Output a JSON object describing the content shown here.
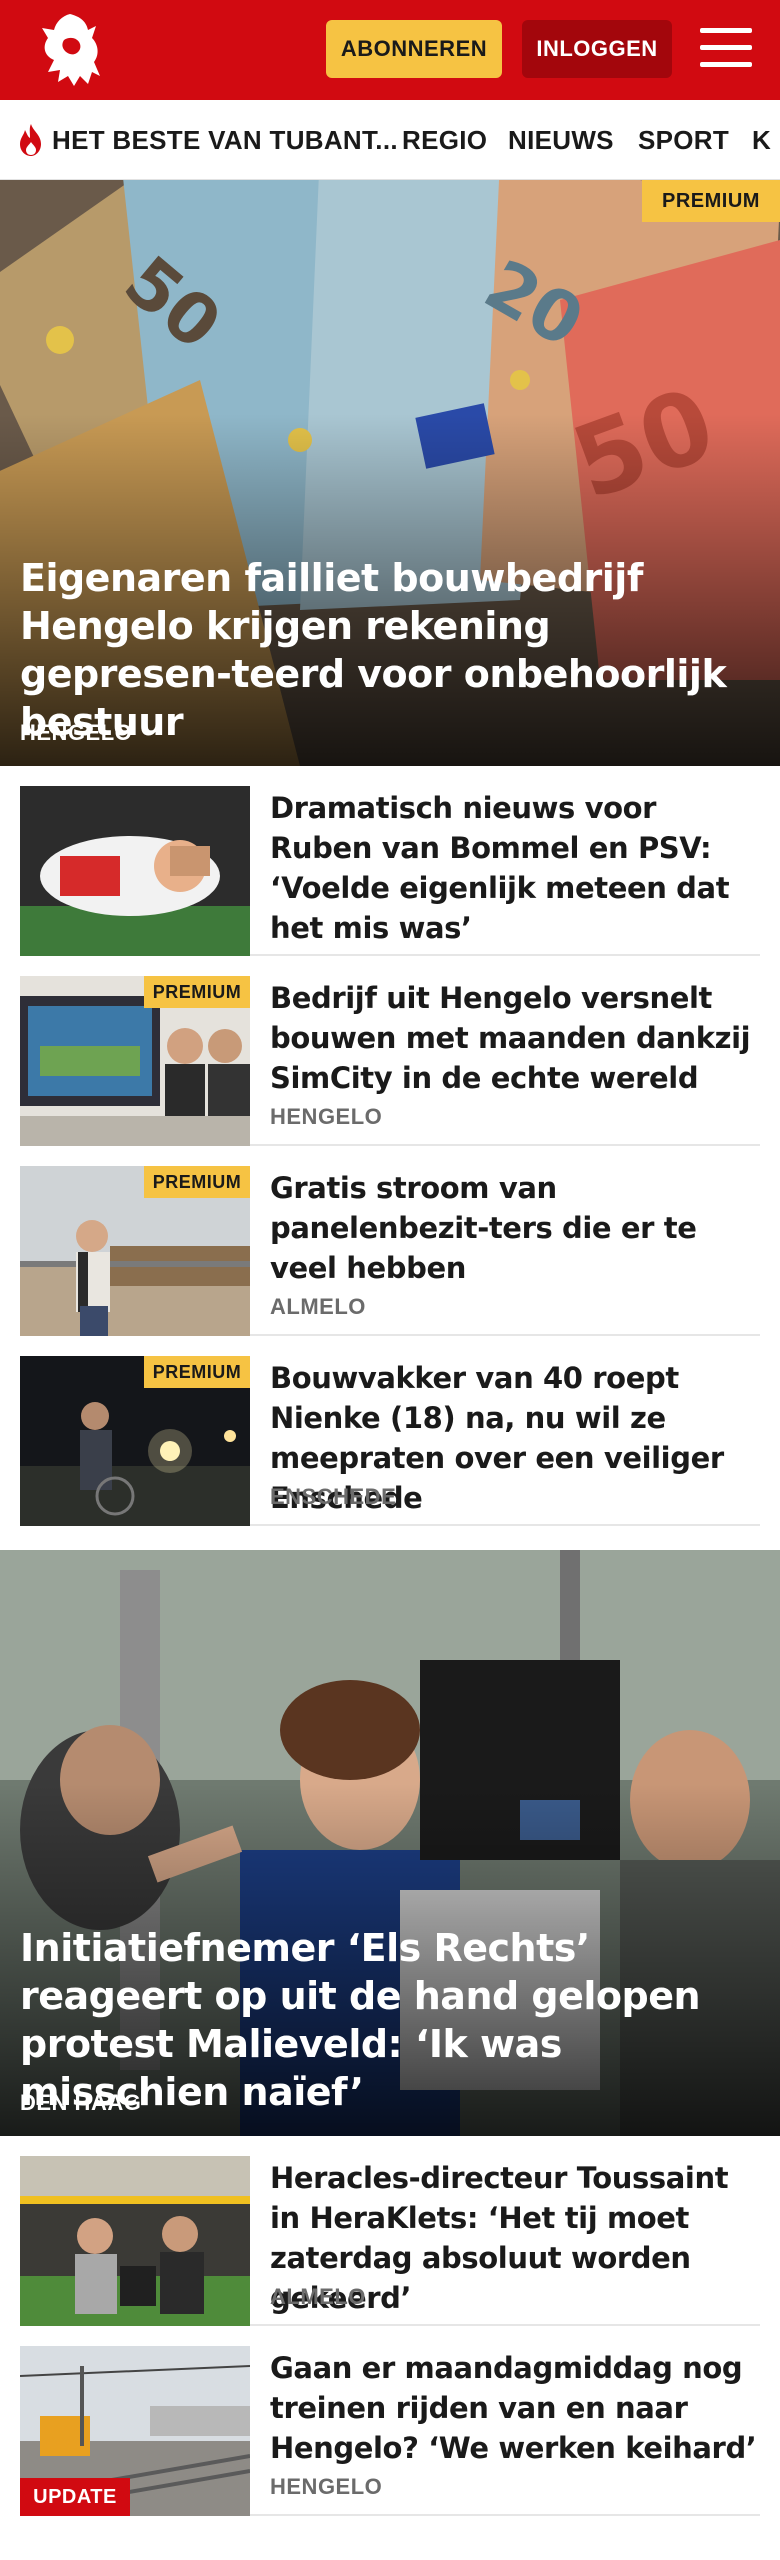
{
  "header": {
    "subscribe_label": "ABONNEREN",
    "login_label": "INLOGGEN",
    "colors": {
      "brand": "#d10a11",
      "accent": "#f6c343",
      "login_bg": "#a3060c"
    }
  },
  "nav": {
    "items": [
      {
        "label": "HET BESTE VAN TUBANT...",
        "icon": "flame-icon"
      },
      {
        "label": "REGIO"
      },
      {
        "label": "NIEUWS"
      },
      {
        "label": "SPORT"
      },
      {
        "label": "K"
      }
    ]
  },
  "articles": {
    "hero1": {
      "badge": "PREMIUM",
      "title": "Eigenaren failliet bouwbedrijf Hengelo krijgen rekening gepresen-teerd voor onbehoorlijk bestuur",
      "location": "HENGELO"
    },
    "list1": [
      {
        "title": "Dramatisch nieuws voor Ruben van Bommel en PSV: ‘Voelde eigenlijk meteen dat het mis was’",
        "location": ""
      },
      {
        "badge": "PREMIUM",
        "title": "Bedrijf uit Hengelo versnelt bouwen met maanden dankzij SimCity in de echte wereld",
        "location": "HENGELO"
      },
      {
        "badge": "PREMIUM",
        "title": "Gratis stroom van panelenbezit-ters die er te veel hebben",
        "location": "ALMELO"
      },
      {
        "badge": "PREMIUM",
        "title": "Bouwvakker van 40 roept Nienke (18) na, nu wil ze meepraten over een veiliger Enschede",
        "location": "ENSCHEDE"
      }
    ],
    "hero2": {
      "title": "Initiatiefnemer ‘Els Rechts’ reageert op uit de hand gelopen protest Malieveld: ‘Ik was misschien naïef’",
      "location": "DEN HAAG"
    },
    "list2": [
      {
        "title": "Heracles-directeur Toussaint in HeraKlets: ‘Het tij moet zaterdag absoluut worden gekeerd’",
        "location": "ALMELO"
      },
      {
        "badge": "UPDATE",
        "title": "Gaan er maandagmiddag nog treinen rijden van en naar Hengelo? ‘We werken keihard’",
        "location": "HENGELO"
      }
    ]
  }
}
